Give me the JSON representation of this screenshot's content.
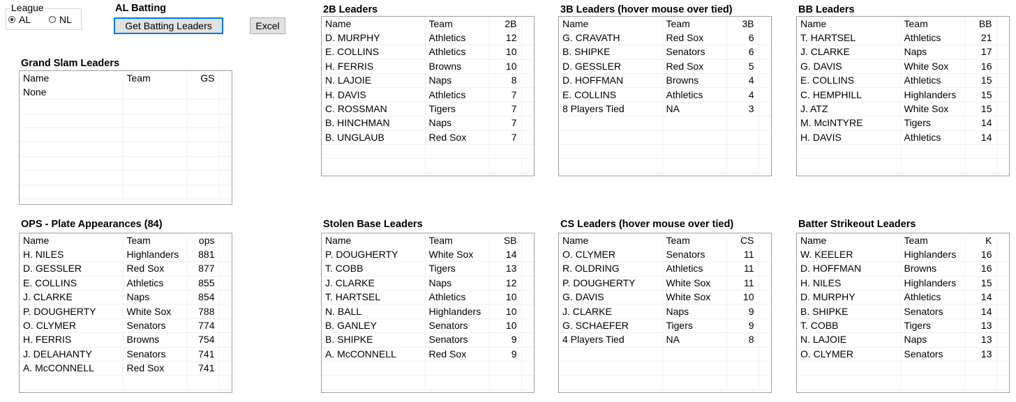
{
  "league": {
    "label": "League",
    "options": [
      {
        "label": "AL",
        "selected": true
      },
      {
        "label": "NL",
        "selected": false
      }
    ]
  },
  "header": {
    "title": "AL Batting",
    "get_button": "Get Batting Leaders",
    "excel_button": "Excel"
  },
  "tables": {
    "grand_slam": {
      "title": "Grand Slam Leaders",
      "columns": [
        "Name",
        "Team",
        "GS"
      ],
      "rows": [
        [
          "None",
          "",
          ""
        ]
      ]
    },
    "doubles": {
      "title": "2B Leaders",
      "columns": [
        "Name",
        "Team",
        "2B"
      ],
      "rows": [
        [
          "D. MURPHY",
          "Athletics",
          "12"
        ],
        [
          "E. COLLINS",
          "Athletics",
          "10"
        ],
        [
          "H. FERRIS",
          "Browns",
          "10"
        ],
        [
          "N. LAJOIE",
          "Naps",
          "8"
        ],
        [
          "H. DAVIS",
          "Athletics",
          "7"
        ],
        [
          "C. ROSSMAN",
          "Tigers",
          "7"
        ],
        [
          "B. HINCHMAN",
          "Naps",
          "7"
        ],
        [
          "B. UNGLAUB",
          "Red Sox",
          "7"
        ]
      ]
    },
    "triples": {
      "title": "3B Leaders (hover mouse over tied)",
      "columns": [
        "Name",
        "Team",
        "3B"
      ],
      "rows": [
        [
          "G. CRAVATH",
          "Red Sox",
          "6"
        ],
        [
          "B. SHIPKE",
          "Senators",
          "6"
        ],
        [
          "D. GESSLER",
          "Red Sox",
          "5"
        ],
        [
          "D. HOFFMAN",
          "Browns",
          "4"
        ],
        [
          "E. COLLINS",
          "Athletics",
          "4"
        ],
        [
          "8 Players Tied",
          "NA",
          "3"
        ]
      ]
    },
    "walks": {
      "title": "BB Leaders",
      "columns": [
        "Name",
        "Team",
        "BB"
      ],
      "rows": [
        [
          "T. HARTSEL",
          "Athletics",
          "21"
        ],
        [
          "J. CLARKE",
          "Naps",
          "17"
        ],
        [
          "G. DAVIS",
          "White Sox",
          "16"
        ],
        [
          "E. COLLINS",
          "Athletics",
          "15"
        ],
        [
          "C. HEMPHILL",
          "Highlanders",
          "15"
        ],
        [
          "J. ATZ",
          "White Sox",
          "15"
        ],
        [
          "M. McINTYRE",
          "Tigers",
          "14"
        ],
        [
          "H. DAVIS",
          "Athletics",
          "14"
        ]
      ]
    },
    "ops": {
      "title": "OPS - Plate Appearances (84)",
      "columns": [
        "Name",
        "Team",
        "ops"
      ],
      "rows": [
        [
          "H. NILES",
          "Highlanders",
          "881"
        ],
        [
          "D. GESSLER",
          "Red Sox",
          "877"
        ],
        [
          "E. COLLINS",
          "Athletics",
          "855"
        ],
        [
          "J. CLARKE",
          "Naps",
          "854"
        ],
        [
          "P. DOUGHERTY",
          "White Sox",
          "788"
        ],
        [
          "O. CLYMER",
          "Senators",
          "774"
        ],
        [
          "H. FERRIS",
          "Browns",
          "754"
        ],
        [
          "J. DELAHANTY",
          "Senators",
          "741"
        ],
        [
          "A. McCONNELL",
          "Red Sox",
          "741"
        ]
      ]
    },
    "stolen_bases": {
      "title": "Stolen Base Leaders",
      "columns": [
        "Name",
        "Team",
        "SB"
      ],
      "rows": [
        [
          "P. DOUGHERTY",
          "White Sox",
          "14"
        ],
        [
          "T. COBB",
          "Tigers",
          "13"
        ],
        [
          "J. CLARKE",
          "Naps",
          "12"
        ],
        [
          "T. HARTSEL",
          "Athletics",
          "10"
        ],
        [
          "N. BALL",
          "Highlanders",
          "10"
        ],
        [
          "B. GANLEY",
          "Senators",
          "10"
        ],
        [
          "B. SHIPKE",
          "Senators",
          "9"
        ],
        [
          "A. McCONNELL",
          "Red Sox",
          "9"
        ]
      ]
    },
    "caught_stealing": {
      "title": "CS Leaders (hover mouse over tied)",
      "columns": [
        "Name",
        "Team",
        "CS"
      ],
      "rows": [
        [
          "O. CLYMER",
          "Senators",
          "11"
        ],
        [
          "R. OLDRING",
          "Athletics",
          "11"
        ],
        [
          "P. DOUGHERTY",
          "White Sox",
          "11"
        ],
        [
          "G. DAVIS",
          "White Sox",
          "10"
        ],
        [
          "J. CLARKE",
          "Naps",
          "9"
        ],
        [
          "G. SCHAEFER",
          "Tigers",
          "9"
        ],
        [
          "4 Players Tied",
          "NA",
          "8"
        ]
      ]
    },
    "strikeouts": {
      "title": "Batter Strikeout Leaders",
      "columns": [
        "Name",
        "Team",
        "K"
      ],
      "rows": [
        [
          "W. KEELER",
          "Highlanders",
          "16"
        ],
        [
          "D. HOFFMAN",
          "Browns",
          "16"
        ],
        [
          "H. NILES",
          "Highlanders",
          "15"
        ],
        [
          "D. MURPHY",
          "Athletics",
          "14"
        ],
        [
          "B. SHIPKE",
          "Senators",
          "14"
        ],
        [
          "T. COBB",
          "Tigers",
          "13"
        ],
        [
          "N. LAJOIE",
          "Naps",
          "13"
        ],
        [
          "O. CLYMER",
          "Senators",
          "13"
        ]
      ]
    }
  }
}
